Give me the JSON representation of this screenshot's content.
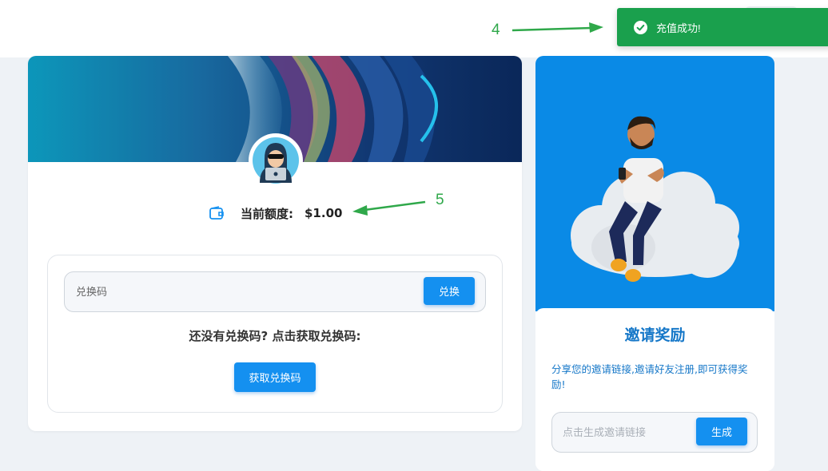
{
  "toast": {
    "message": "充值成功!",
    "icon": "check-circle-icon",
    "color": "#1aa04d"
  },
  "annotations": {
    "label_4": "4",
    "label_5": "5"
  },
  "account": {
    "quota_label": "当前额度:",
    "quota_value": "$1.00",
    "wallet_icon": "wallet-icon",
    "avatar_icon": "hacker-avatar-icon"
  },
  "redeem": {
    "placeholder": "兑换码",
    "button": "兑换",
    "no_code_text": "还没有兑换码? 点击获取兑换码:",
    "get_code_button": "获取兑换码"
  },
  "invite": {
    "title": "邀请奖励",
    "description": "分享您的邀请链接,邀请好友注册,即可获得奖励!",
    "placeholder": "点击生成邀请链接",
    "button": "生成"
  },
  "colors": {
    "accent": "#1490f0",
    "success": "#1aa04d",
    "annotation": "#2fa84a",
    "invite_text": "#1577c8"
  }
}
